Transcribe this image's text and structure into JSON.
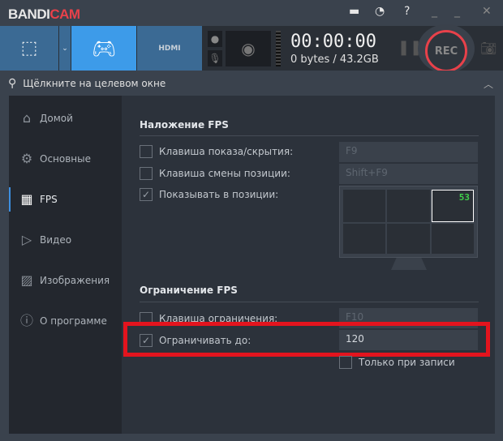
{
  "app": {
    "logo_main": "BANDI",
    "logo_accent": "CAM"
  },
  "titlebar": {
    "icons": [
      "folder-icon",
      "clock-icon",
      "help-icon",
      "minimize-icon",
      "maximize-icon",
      "close-icon"
    ]
  },
  "toolbar": {
    "timer": "00:00:00",
    "size": "0 bytes / 43.2GB",
    "rec_label": "REC",
    "hdmi_label": "HDMI"
  },
  "search": {
    "text": "Щёлкните на целевом окне"
  },
  "sidebar": {
    "items": [
      {
        "label": "Домой"
      },
      {
        "label": "Основные"
      },
      {
        "label": "FPS"
      },
      {
        "label": "Видео"
      },
      {
        "label": "Изображения"
      },
      {
        "label": "О программе"
      }
    ]
  },
  "fps_overlay": {
    "heading": "Наложение FPS",
    "show_hide_label": "Клавиша показа/скрытия:",
    "show_hide_key": "F9",
    "show_hide_checked": false,
    "position_label": "Клавиша смены позиции:",
    "position_key": "Shift+F9",
    "position_checked": false,
    "show_at_label": "Показывать в позиции:",
    "show_at_checked": true,
    "sample_fps": "53",
    "selected_position": "top-right"
  },
  "fps_limit": {
    "heading": "Ограничение FPS",
    "hotkey_label": "Клавиша ограничения:",
    "hotkey_key": "F10",
    "hotkey_checked": false,
    "limit_label": "Ограничивать до:",
    "limit_value": "120",
    "limit_checked": true,
    "only_recording_label": "Только при записи",
    "only_recording_checked": false
  },
  "colors": {
    "accent": "#3d9be9",
    "rec": "#e8414a",
    "highlight": "#e3141e",
    "fps_green": "#3fd04a"
  }
}
